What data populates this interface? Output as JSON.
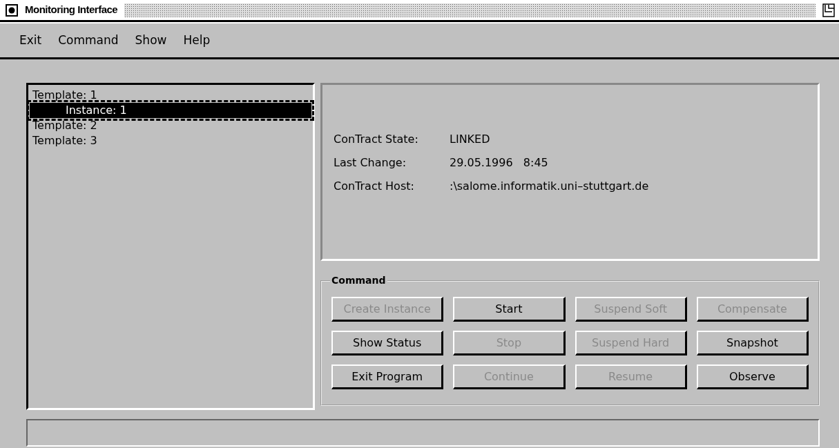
{
  "window": {
    "title": "Monitoring Interface"
  },
  "menu": [
    "Exit",
    "Command",
    "Show",
    "Help"
  ],
  "tree": [
    {
      "label": "Template: 1",
      "selected": false,
      "children": [
        {
          "label": "Instance: 1",
          "selected": true
        }
      ]
    },
    {
      "label": "Template: 2",
      "selected": false
    },
    {
      "label": "Template: 3",
      "selected": false
    }
  ],
  "details": [
    {
      "label": "ConTract State:",
      "value": "LINKED"
    },
    {
      "label": "Last Change:",
      "value": "29.05.1996   8:45"
    },
    {
      "label": "ConTract Host:",
      "value": ":\\salome.informatik.uni–stuttgart.de"
    }
  ],
  "command": {
    "title": "Command",
    "buttons": [
      {
        "label": "Create Instance",
        "disabled": true
      },
      {
        "label": "Start",
        "disabled": false
      },
      {
        "label": "Suspend Soft",
        "disabled": true
      },
      {
        "label": "Compensate",
        "disabled": true
      },
      {
        "label": "Show Status",
        "disabled": false
      },
      {
        "label": "Stop",
        "disabled": true
      },
      {
        "label": "Suspend Hard",
        "disabled": true
      },
      {
        "label": "Snapshot",
        "disabled": false
      },
      {
        "label": "Exit Program",
        "disabled": false
      },
      {
        "label": "Continue",
        "disabled": true
      },
      {
        "label": "Resume",
        "disabled": true
      },
      {
        "label": "Observe",
        "disabled": false
      }
    ]
  }
}
